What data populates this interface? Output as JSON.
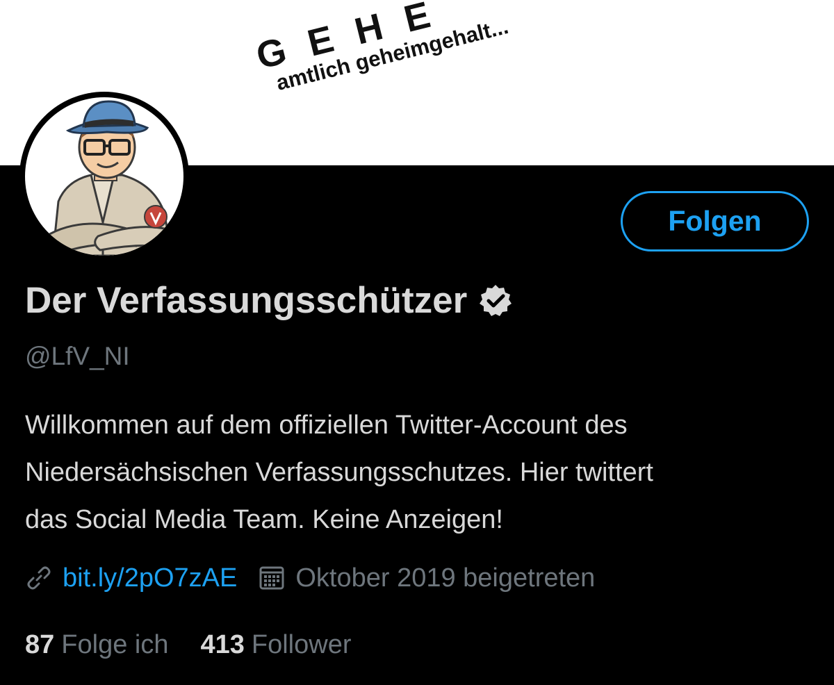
{
  "banner": {
    "stamp_big": "GEHE",
    "stamp_small": "amtlich geheimgehalt..."
  },
  "profile": {
    "avatar_description": "cartoon-agent-avatar",
    "follow_label": "Folgen",
    "display_name": "Der Verfassungsschützer",
    "verified_icon": "verified-badge-icon",
    "handle": "@LfV_NI",
    "bio_lines": [
      "Willkommen auf dem offiziellen Twitter-Account des",
      "Niedersächsischen Verfassungsschutzes. Hier twittert",
      "das Social Media Team. Keine Anzeigen!"
    ],
    "link_icon": "link-icon",
    "link": "bit.ly/2pO7zAE",
    "calendar_icon": "calendar-icon",
    "joined": "Oktober 2019 beigetreten",
    "following_count": "87",
    "following_label": "Folge ich",
    "followers_count": "413",
    "followers_label": "Follower"
  },
  "colors": {
    "background": "#000000",
    "accent": "#1da1f2",
    "primary_text": "#d9d9d9",
    "secondary_text": "#6e767d"
  }
}
